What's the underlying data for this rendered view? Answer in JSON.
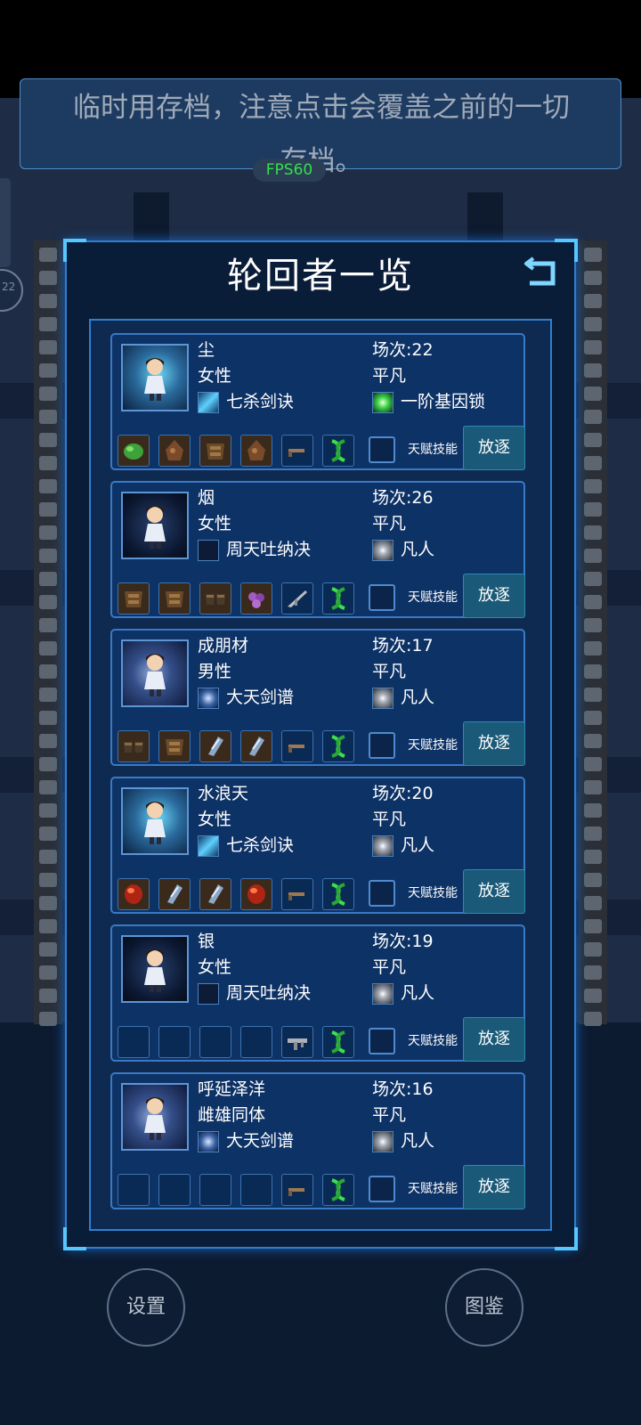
{
  "notice": {
    "line1": "临时用存档，注意点击会覆盖之前的一切",
    "line2": "存档。"
  },
  "fps": "FPS60",
  "side": {
    "badge": "22"
  },
  "panel": {
    "title": "轮回者一览",
    "back_icon": "return-arrow"
  },
  "characters": [
    {
      "name": "尘",
      "gender": "女性",
      "skill": "七杀剑诀",
      "skill_icon": "qisha",
      "rounds": "场次:22",
      "rank": "平凡",
      "gene": "一阶基因锁",
      "gene_icon": "gene-lock",
      "portrait": "a",
      "slots": [
        "green-ore",
        "brown-ore",
        "armor",
        "brown-ore",
        "gun",
        "dna"
      ]
    },
    {
      "name": "烟",
      "gender": "女性",
      "skill": "周天吐纳决",
      "skill_icon": "zhoutian",
      "rounds": "场次:26",
      "rank": "平凡",
      "gene": "凡人",
      "gene_icon": "mortal",
      "portrait": "b",
      "slots": [
        "armor",
        "armor",
        "gloves",
        "purple-ore",
        "rifle",
        "dna"
      ]
    },
    {
      "name": "成朋材",
      "gender": "男性",
      "skill": "大天剑谱",
      "skill_icon": "datian",
      "rounds": "场次:17",
      "rank": "平凡",
      "gene": "凡人",
      "gene_icon": "mortal",
      "portrait": "c",
      "slots": [
        "gloves",
        "armor",
        "crystal",
        "crystal",
        "gun",
        "dna"
      ]
    },
    {
      "name": "水浪天",
      "gender": "女性",
      "skill": "七杀剑诀",
      "skill_icon": "qisha",
      "rounds": "场次:20",
      "rank": "平凡",
      "gene": "凡人",
      "gene_icon": "mortal",
      "portrait": "a",
      "slots": [
        "red-gem",
        "crystal",
        "crystal",
        "red-gem",
        "gun",
        "dna"
      ]
    },
    {
      "name": "银",
      "gender": "女性",
      "skill": "周天吐纳决",
      "skill_icon": "zhoutian",
      "rounds": "场次:19",
      "rank": "平凡",
      "gene": "凡人",
      "gene_icon": "mortal",
      "portrait": "b",
      "slots": [
        "empty",
        "empty",
        "empty",
        "empty",
        "smg",
        "dna"
      ]
    },
    {
      "name": "呼延泽洋",
      "gender": "雌雄同体",
      "skill": "大天剑谱",
      "skill_icon": "datian",
      "rounds": "场次:16",
      "rank": "平凡",
      "gene": "凡人",
      "gene_icon": "mortal",
      "portrait": "c",
      "slots": [
        "empty",
        "empty",
        "empty",
        "empty",
        "gun",
        "dna"
      ]
    }
  ],
  "labels": {
    "talent": "天赋技能",
    "exile": "放逐"
  },
  "bottom": {
    "settings": "设置",
    "codex": "图鉴"
  }
}
